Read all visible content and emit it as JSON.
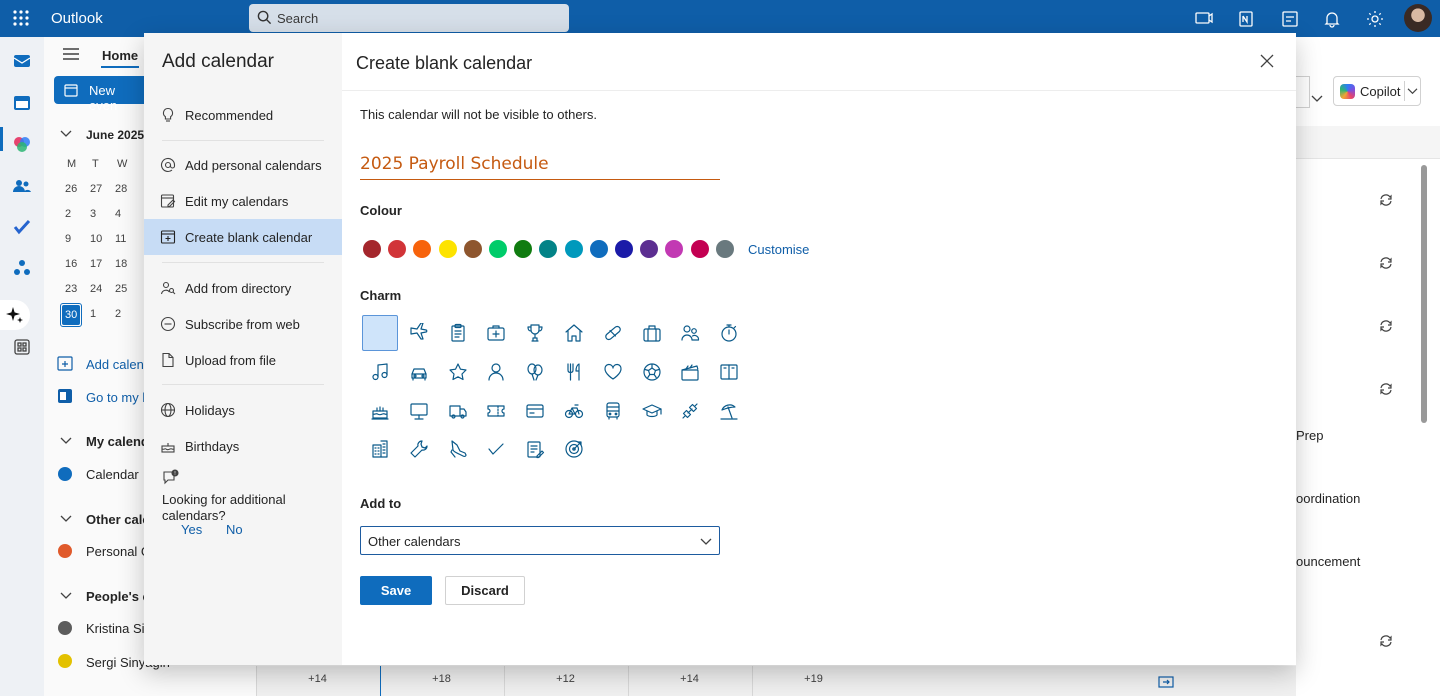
{
  "app": {
    "name": "Outlook",
    "search_placeholder": "Search"
  },
  "background": {
    "home_tab": "Home",
    "new_event": "New even",
    "month_label": "June 2025",
    "weekdays": [
      "M",
      "T",
      "W"
    ],
    "weeks": [
      [
        "26",
        "27",
        "28"
      ],
      [
        "2",
        "3",
        "4"
      ],
      [
        "9",
        "10",
        "11"
      ],
      [
        "16",
        "17",
        "18"
      ],
      [
        "23",
        "24",
        "25"
      ],
      [
        "30",
        "1",
        "2"
      ]
    ],
    "add_calendar": "Add calen",
    "go_to_my": "Go to my l",
    "my_calendars": "My calend",
    "calendar": "Calendar",
    "other_calendars": "Other cale",
    "personal": "Personal G",
    "peoples_calendars": "People's c",
    "kristina": "Kristina Si",
    "sergi": "Sergi Sinyagin",
    "copilot": "Copilot",
    "right_events": [
      "Prep",
      "oordination",
      "ouncement"
    ],
    "bottom_counts": [
      "+14",
      "+18",
      "+12",
      "+14",
      "+19"
    ]
  },
  "dialog": {
    "left_title": "Add calendar",
    "nav": [
      {
        "label": "Recommended",
        "icon": "lightbulb-icon"
      },
      {
        "label": "Add personal calendars",
        "icon": "at-sign-icon"
      },
      {
        "label": "Edit my calendars",
        "icon": "edit-calendar-icon"
      },
      {
        "label": "Create blank calendar",
        "icon": "calendar-add-icon"
      },
      {
        "label": "Add from directory",
        "icon": "people-search-icon"
      },
      {
        "label": "Subscribe from web",
        "icon": "subscribe-icon"
      },
      {
        "label": "Upload from file",
        "icon": "upload-file-icon"
      },
      {
        "label": "Holidays",
        "icon": "globe-icon"
      },
      {
        "label": "Birthdays",
        "icon": "cake-icon"
      }
    ],
    "looking_text": "Looking for additional calendars?",
    "yes": "Yes",
    "no": "No",
    "title": "Create blank calendar",
    "note": "This calendar will not be visible to others.",
    "calendar_name": "2025 Payroll Schedule",
    "colour_label": "Colour",
    "colours": [
      "#a4262c",
      "#d13438",
      "#f7630c",
      "#fde300",
      "#8e562e",
      "#00cc6a",
      "#107c10",
      "#038387",
      "#0099bc",
      "#0f6cbd",
      "#1b1ba8",
      "#5c2e91",
      "#c239b3",
      "#c30052",
      "#69797e"
    ],
    "customise": "Customise",
    "charm_label": "Charm",
    "charms": [
      "blank",
      "airplane-icon",
      "clipboard-icon",
      "medical-bag-icon",
      "trophy-icon",
      "home-icon",
      "pill-icon",
      "briefcase-icon",
      "people-icon",
      "stopwatch-icon",
      "music-note-icon",
      "car-icon",
      "star-icon",
      "person-icon",
      "balloons-icon",
      "fork-knife-icon",
      "heart-icon",
      "soccer-ball-icon",
      "movie-clapper-icon",
      "book-icon",
      "birthday-cake-icon",
      "monitor-icon",
      "truck-icon",
      "ticket-icon",
      "credit-card-icon",
      "bicycle-icon",
      "bus-icon",
      "graduation-cap-icon",
      "dumbbell-icon",
      "beach-icon",
      "building-icon",
      "wrench-icon",
      "shoe-icon",
      "checkmark-icon",
      "notepad-icon",
      "target-icon"
    ],
    "add_to_label": "Add to",
    "add_to_value": "Other calendars",
    "save": "Save",
    "discard": "Discard"
  }
}
